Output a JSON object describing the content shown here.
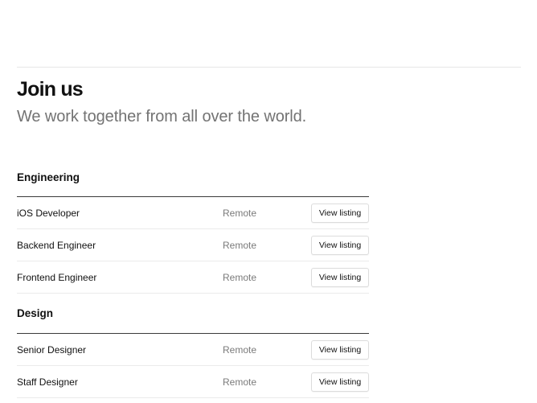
{
  "header": {
    "title": "Join us",
    "subtitle": "We work together from all over the world."
  },
  "groups": [
    {
      "name": "Engineering",
      "jobs": [
        {
          "title": "iOS Developer",
          "location": "Remote",
          "action": "View listing"
        },
        {
          "title": "Backend Engineer",
          "location": "Remote",
          "action": "View listing"
        },
        {
          "title": "Frontend Engineer",
          "location": "Remote",
          "action": "View listing"
        }
      ]
    },
    {
      "name": "Design",
      "jobs": [
        {
          "title": "Senior Designer",
          "location": "Remote",
          "action": "View listing"
        },
        {
          "title": "Staff Designer",
          "location": "Remote",
          "action": "View listing"
        }
      ]
    }
  ]
}
